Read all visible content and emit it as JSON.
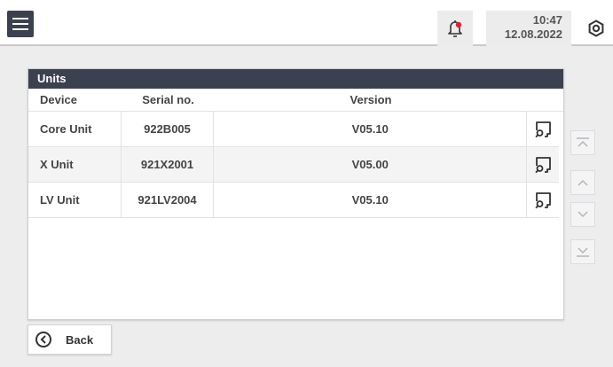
{
  "header": {
    "menu_icon": "hamburger-menu-icon",
    "alarm_icon": "bell-alarm-icon",
    "alarm_dot_color": "#e0242f",
    "time": "10:47",
    "date": "12.08.2022",
    "settings_icon": "gear-icon"
  },
  "panel": {
    "title": "Units",
    "columns": [
      "Device",
      "Serial no.",
      "Version"
    ],
    "rows": [
      {
        "device": "Core Unit",
        "serial": "922B005",
        "version": "V05.10",
        "action_icon": "details-search-icon"
      },
      {
        "device": "X Unit",
        "serial": "921X2001",
        "version": "V05.00",
        "action_icon": "details-search-icon"
      },
      {
        "device": "LV Unit",
        "serial": "921LV2004",
        "version": "V05.10",
        "action_icon": "details-search-icon"
      }
    ]
  },
  "scroll": {
    "icons": [
      "scroll-top-icon",
      "scroll-up-icon",
      "scroll-down-icon",
      "scroll-bottom-icon"
    ]
  },
  "footer": {
    "back_label": "Back",
    "back_icon": "chevron-left-circle-icon"
  },
  "colors": {
    "dark_header": "#3c4150",
    "background": "#ededee"
  }
}
